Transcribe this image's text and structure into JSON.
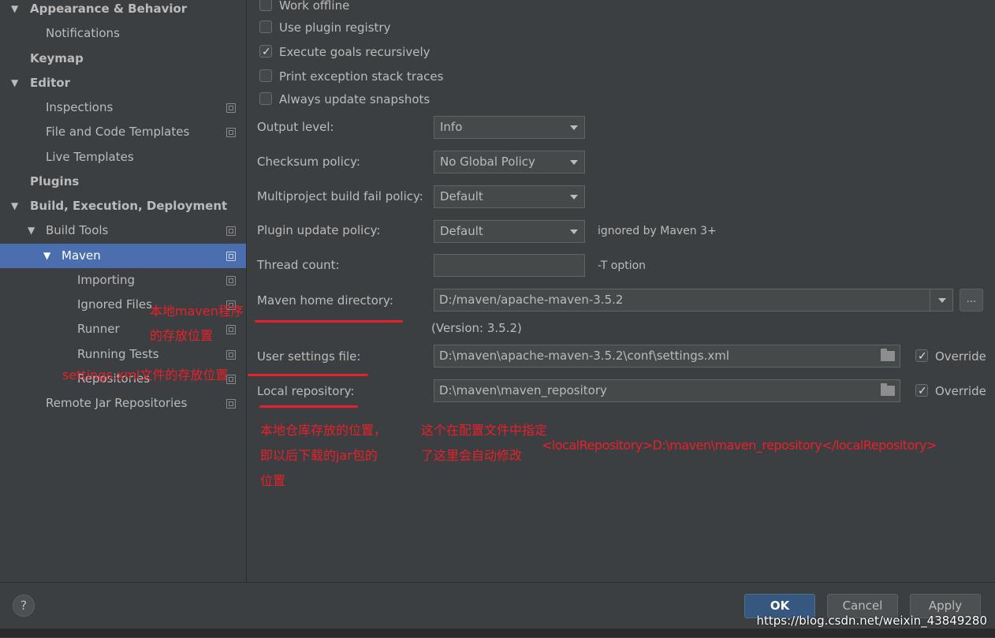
{
  "sidebar": {
    "items": [
      {
        "label": "Appearance & Behavior",
        "arrow": "▼"
      },
      {
        "label": "Notifications"
      },
      {
        "label": "Keymap"
      },
      {
        "label": "Editor",
        "arrow": "▼"
      },
      {
        "label": "Inspections"
      },
      {
        "label": "File and Code Templates"
      },
      {
        "label": "Live Templates"
      },
      {
        "label": "Plugins"
      },
      {
        "label": "Build, Execution, Deployment",
        "arrow": "▼"
      },
      {
        "label": "Build Tools",
        "arrow": "▼"
      },
      {
        "label": "Maven",
        "arrow": "▼",
        "selected": true
      },
      {
        "label": "Importing"
      },
      {
        "label": "Ignored Files"
      },
      {
        "label": "Runner"
      },
      {
        "label": "Running Tests"
      },
      {
        "label": "Repositories"
      },
      {
        "label": "Remote Jar Repositories"
      }
    ]
  },
  "checkboxes": [
    {
      "label": "Work offline",
      "checked": false
    },
    {
      "label": "Use plugin registry",
      "checked": false
    },
    {
      "label": "Execute goals recursively",
      "checked": true
    },
    {
      "label": "Print exception stack traces",
      "checked": false
    },
    {
      "label": "Always update snapshots",
      "checked": false
    }
  ],
  "settings": {
    "output_level": {
      "label": "Output level:",
      "value": "Info"
    },
    "checksum_policy": {
      "label": "Checksum policy:",
      "value": "No Global Policy"
    },
    "fail_policy": {
      "label": "Multiproject build fail policy:",
      "value": "Default"
    },
    "plugin_update": {
      "label": "Plugin update policy:",
      "value": "Default",
      "hint": "ignored by Maven 3+"
    },
    "thread_count": {
      "label": "Thread count:",
      "value": "",
      "hint": "-T option"
    },
    "maven_home": {
      "label": "Maven home directory:",
      "value": "D:/maven/apache-maven-3.5.2",
      "version": "(Version: 3.5.2)",
      "browse": "..."
    },
    "user_settings": {
      "label": "User settings file:",
      "value": "D:\\maven\\apache-maven-3.5.2\\conf\\settings.xml",
      "override": "Override",
      "override_checked": true
    },
    "local_repo": {
      "label": "Local repository:",
      "value": "D:\\maven\\maven_repository",
      "override": "Override",
      "override_checked": true
    }
  },
  "annotations": {
    "maven_home_note_1": "本地maven程序",
    "maven_home_note_2": "的存放位置",
    "settings_note": "settings.xml文件的存放位置",
    "repo_note_1": "本地仓库存放的位置，",
    "repo_note_2": "即以后下载的jar包的",
    "repo_note_3": "位置",
    "config_note_1": "这个在配置文件中指定",
    "config_note_2": "了这里会自动修改",
    "config_tag": "<localRepository>D:\\maven\\maven_repository</localRepository>"
  },
  "footer": {
    "help": "?",
    "ok": "OK",
    "cancel": "Cancel",
    "apply": "Apply"
  },
  "watermark": "https://blog.csdn.net/weixin_43849280",
  "colors": {
    "background": "#3c3f41",
    "selection": "#4b6eaf",
    "annotation_red": "#e8202a",
    "primary_button": "#365880"
  }
}
